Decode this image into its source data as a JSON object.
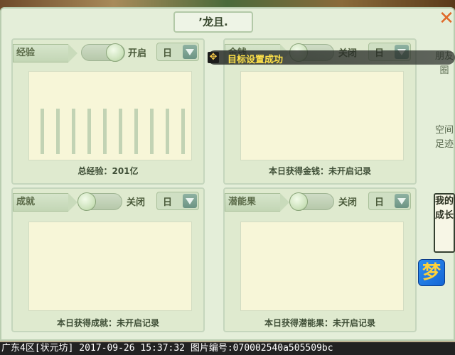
{
  "window": {
    "title": "’龙且."
  },
  "panels": {
    "experience": {
      "label": "经验",
      "toggle_label": "开启",
      "toggle_on": true,
      "period": "日",
      "caption": "总经验：201亿",
      "chart_data": {
        "type": "bar",
        "values": [
          1,
          1,
          1,
          1,
          1,
          1,
          1,
          1,
          1,
          1
        ]
      }
    },
    "money": {
      "label": "金钱",
      "toggle_label": "关闭",
      "toggle_on": false,
      "period": "日",
      "caption": "本日获得金钱：未开启记录"
    },
    "achievement": {
      "label": "成就",
      "toggle_label": "关闭",
      "toggle_on": false,
      "period": "日",
      "caption": "本日获得成就：未开启记录"
    },
    "potential": {
      "label": "潜能果",
      "toggle_label": "关闭",
      "toggle_on": false,
      "period": "日",
      "caption": "本日获得潜能果：未开启记录"
    }
  },
  "side_tabs": [
    {
      "label": "朋友圈"
    },
    {
      "label": "空间足迹"
    },
    {
      "label": "我的成长"
    }
  ],
  "toast": {
    "text": "目标设置成功"
  },
  "statusbar": {
    "text": "广东4区[状元坊] 2017-09-26 15:37:32 图片编号:070002540a505509bc"
  },
  "dream_logo": {
    "glyph": "梦"
  }
}
